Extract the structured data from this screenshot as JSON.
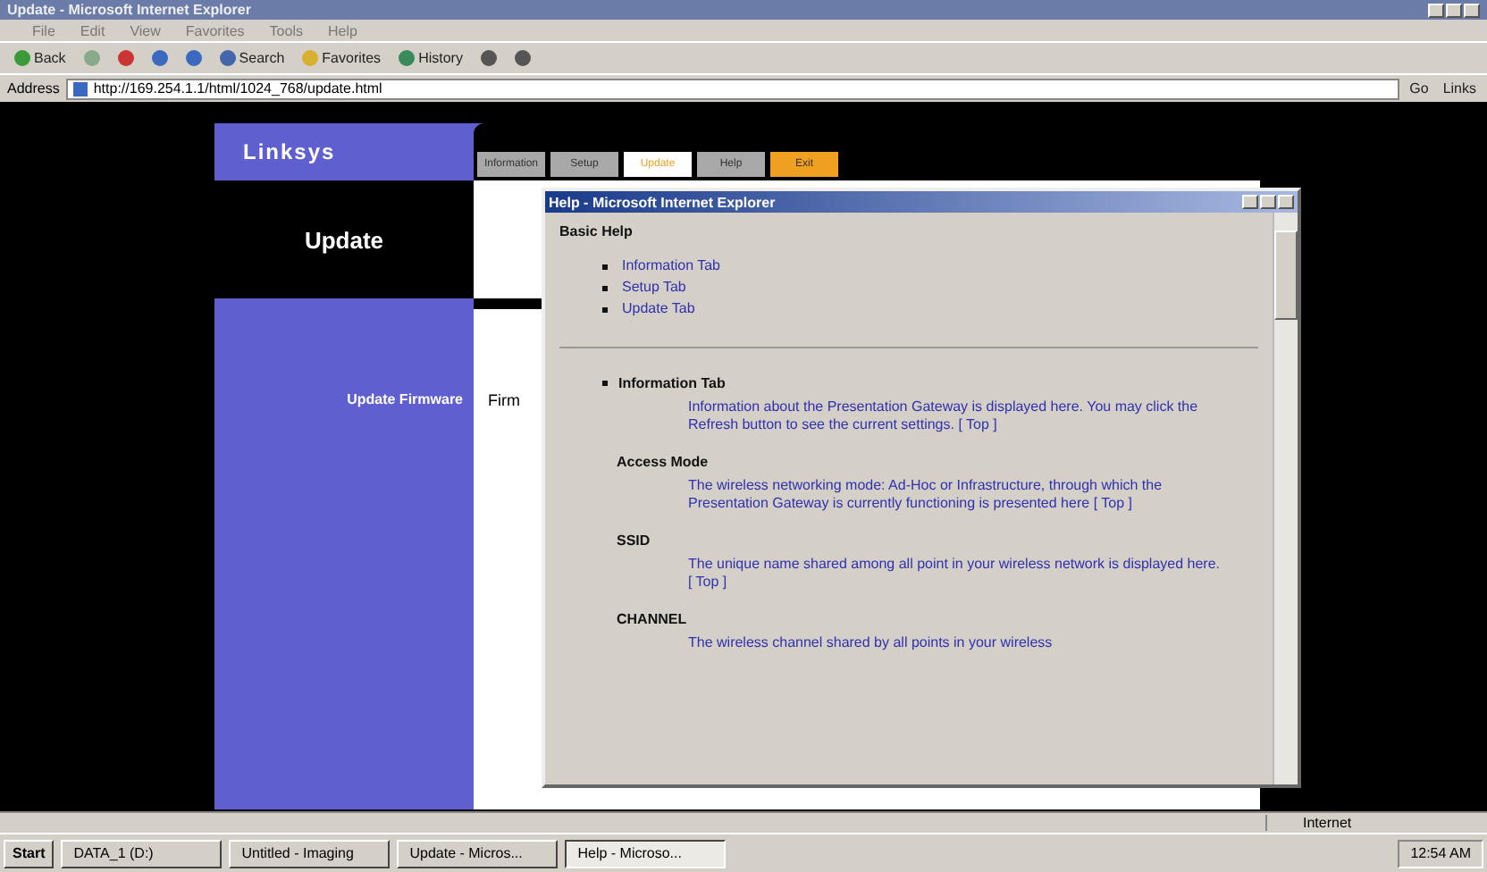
{
  "window": {
    "title": "Update - Microsoft Internet Explorer"
  },
  "menu": [
    "File",
    "Edit",
    "View",
    "Favorites",
    "Tools",
    "Help"
  ],
  "toolbar": [
    {
      "kind": "back",
      "label": "Back"
    },
    {
      "kind": "forward"
    },
    {
      "kind": "stop"
    },
    {
      "kind": "refresh"
    },
    {
      "kind": "home"
    },
    {
      "kind": "search",
      "label": "Search"
    },
    {
      "kind": "favorites",
      "label": "Favorites"
    },
    {
      "kind": "history",
      "label": "History"
    },
    {
      "kind": "mail"
    },
    {
      "kind": "print"
    }
  ],
  "address": {
    "label": "Address",
    "value": "http://169.254.1.1/html/1024_768/update.html",
    "go": "Go",
    "links": "Links"
  },
  "page": {
    "logo": "Linksys",
    "tabs": [
      {
        "label": "Information",
        "selected": false,
        "kind": "normal"
      },
      {
        "label": "Setup",
        "selected": false,
        "kind": "normal"
      },
      {
        "label": "Update",
        "selected": true,
        "kind": "normal"
      },
      {
        "label": "Help",
        "selected": false,
        "kind": "normal"
      },
      {
        "label": "Exit",
        "selected": false,
        "kind": "exit"
      }
    ],
    "section_title": "Update",
    "row_label": "Update Firmware",
    "row_value": "Firm"
  },
  "help_window": {
    "title": "Help - Microsoft Internet Explorer",
    "heading": "Basic Help",
    "links": [
      "Information Tab",
      "Setup Tab",
      "Update Tab"
    ],
    "sections": [
      {
        "kind": "bullet",
        "title": "Information Tab",
        "text": "Information about the Presentation Gateway is displayed here. You may click the Refresh button to see the current settings.",
        "top": "[ Top ]"
      },
      {
        "kind": "plain",
        "title": "Access Mode",
        "text": "The wireless networking mode: Ad-Hoc or Infrastructure, through which the Presentation Gateway is currently functioning is presented here",
        "top": "[ Top ]"
      },
      {
        "kind": "plain",
        "title": "SSID",
        "text": "The unique name shared among all point in your wireless network is displayed here.",
        "top": "[ Top ]"
      },
      {
        "kind": "plain",
        "title": "CHANNEL",
        "text": "The wireless channel shared by all points in your wireless"
      }
    ]
  },
  "status_bar": {
    "zone": "Internet"
  },
  "taskbar": {
    "start": "Start",
    "tasks": [
      {
        "label": "DATA_1 (D:)",
        "selected": false
      },
      {
        "label": "Untitled - Imaging",
        "selected": false
      },
      {
        "label": "Update - Micros...",
        "selected": false
      },
      {
        "label": "Help - Microso...",
        "selected": true
      }
    ],
    "clock": "12:54 AM"
  }
}
